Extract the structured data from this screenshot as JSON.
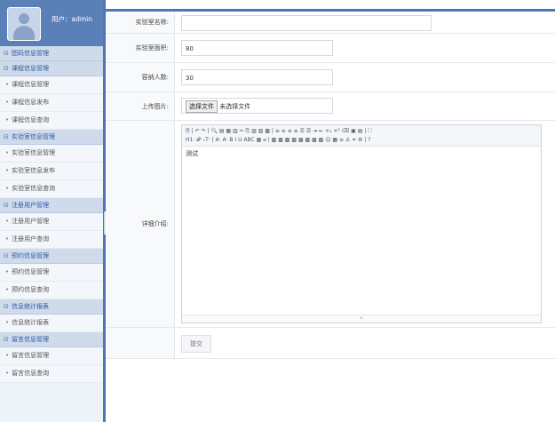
{
  "user": {
    "label": "用户：admin"
  },
  "menu": {
    "groups": [
      {
        "title": "图码信息管理",
        "items": []
      },
      {
        "title": "课程信息管理",
        "items": [
          "课程信息管理",
          "课程信息发布",
          "课程信息查询"
        ]
      },
      {
        "title": "实验室信息管理",
        "items": [
          "实验室信息管理",
          "实验室信息发布",
          "实验室信息查询"
        ]
      },
      {
        "title": "注册用户管理",
        "items": [
          "注册用户管理",
          "注册用户查询"
        ]
      },
      {
        "title": "预约信息管理",
        "items": [
          "预约信息管理",
          "预约信息查询"
        ]
      },
      {
        "title": "信息统计报表",
        "items": [
          "信息统计报表"
        ]
      },
      {
        "title": "留言信息管理",
        "items": [
          "留言信息管理",
          "留言信息查询"
        ]
      }
    ]
  },
  "form": {
    "name_label": "实验室名称:",
    "name_value": "",
    "area_label": "实验室面积:",
    "area_value": "80",
    "capacity_label": "容纳人数:",
    "capacity_value": "30",
    "upload_label": "上传图片:",
    "upload_button": "选择文件",
    "upload_status": "未选择文件",
    "detail_label": "详细介绍:",
    "editor_toolbar_row1": "🗎 | ↶ ↷ | 🔍 ▤ ▦ ▥ ✂ ⎘ ▧ ▨ ▩ | ≡ ≡ ≡ ≡ ☰ ☰ ⇥ ⇤ ×₂ ×² ⌫ ▣ ▤ | ⛶",
    "editor_toolbar_row2": "H1· 𝓕· ₜT· | A· A· B I U ABC ▦ ⌀ | ▩ ▩ ▩ ▩ ▩ ▩ ▩ ▩ ☺ ▦ ≡ ⚓ ⚭ ⚙ | ?",
    "editor_content": "测试",
    "editor_resize": "⌖",
    "submit_label": "提交"
  }
}
